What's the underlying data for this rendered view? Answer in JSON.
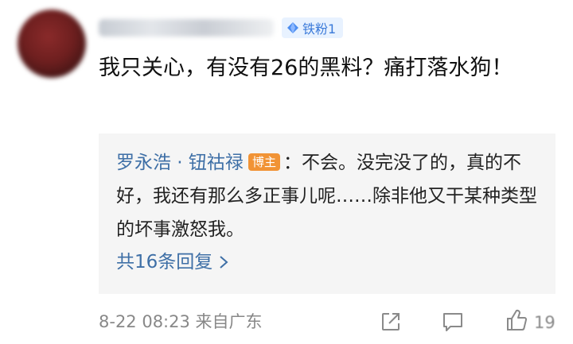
{
  "fan_badge": {
    "label": "铁粉1",
    "icon": "diamond-icon",
    "color": "#3b7ad9"
  },
  "comment": {
    "text": "我只关心，有没有26的黑料？痛打落水狗！"
  },
  "reply": {
    "author": "罗永浩 · 钮祜禄",
    "badge": "博主",
    "text": "：不会。没完没了的，真的不好，我还有那么多正事儿呢……除非他又干某种类型的坏事激怒我。",
    "more_label": "共16条回复"
  },
  "meta": {
    "time_location": "8-22 08:23  来自广东",
    "like_count": "19"
  },
  "colors": {
    "link": "#3e6fa6",
    "badge_bg": "#f19335",
    "meta_gray": "#888888"
  }
}
